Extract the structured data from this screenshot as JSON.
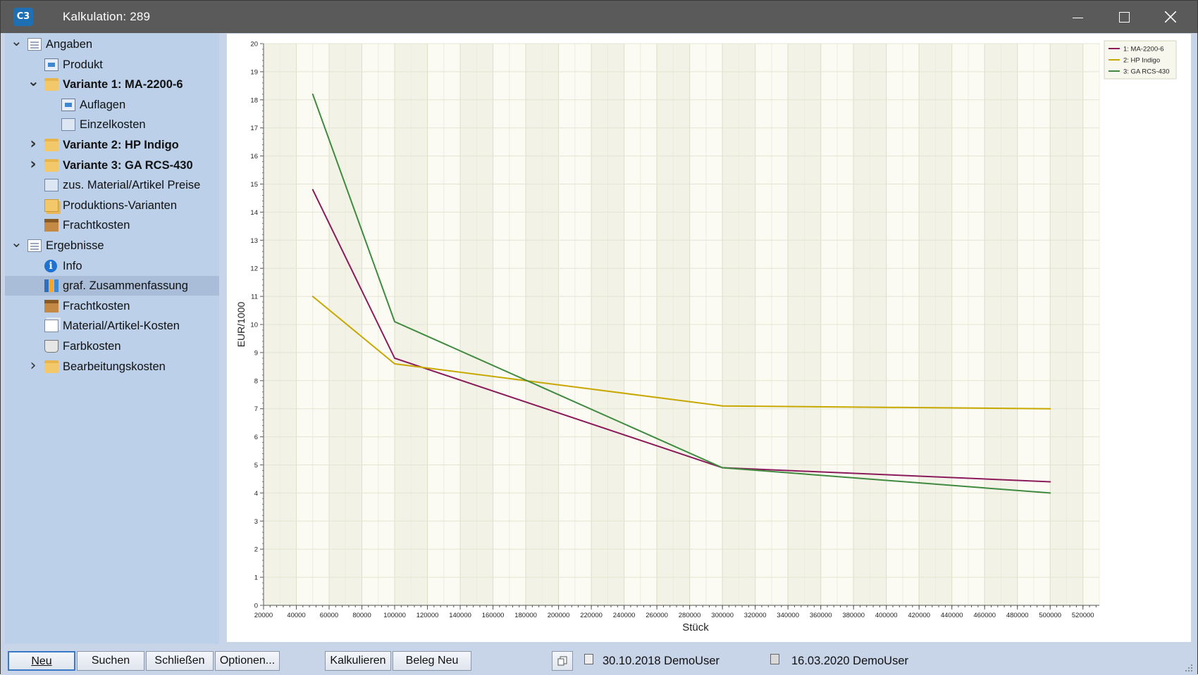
{
  "window": {
    "title": "Kalkulation: 289",
    "app_icon_text": "C3"
  },
  "tree": [
    {
      "label": "Angaben",
      "level": 0,
      "chevron": "expanded",
      "icon": "doc-icon",
      "bold": false
    },
    {
      "label": "Produkt",
      "level": 1,
      "chevron": "none",
      "icon": "monitor-icon",
      "bold": false
    },
    {
      "label": "Variante 1: MA-2200-6",
      "level": 1,
      "chevron": "expanded",
      "icon": "folder-icon",
      "bold": true
    },
    {
      "label": "Auflagen",
      "level": 2,
      "chevron": "none",
      "icon": "monitor-icon",
      "bold": false
    },
    {
      "label": "Einzelkosten",
      "level": 2,
      "chevron": "none",
      "icon": "calc-icon",
      "bold": false
    },
    {
      "label": "Variante 2: HP Indigo",
      "level": 1,
      "chevron": "collapsed",
      "icon": "folder-icon",
      "bold": true
    },
    {
      "label": "Variante 3: GA RCS-430",
      "level": 1,
      "chevron": "collapsed",
      "icon": "folder-icon",
      "bold": true
    },
    {
      "label": "zus. Material/Artikel Preise",
      "level": 1,
      "chevron": "none",
      "icon": "calc-icon",
      "bold": false
    },
    {
      "label": "Produktions-Varianten",
      "level": 1,
      "chevron": "none",
      "icon": "stack-icon",
      "bold": false
    },
    {
      "label": "Frachtkosten",
      "level": 1,
      "chevron": "none",
      "icon": "box-icon",
      "bold": false
    },
    {
      "label": "Ergebnisse",
      "level": 0,
      "chevron": "expanded",
      "icon": "doc-icon",
      "bold": false
    },
    {
      "label": "Info",
      "level": 1,
      "chevron": "none",
      "icon": "info-icon",
      "bold": false
    },
    {
      "label": "graf. Zusammenfassung",
      "level": 1,
      "chevron": "none",
      "icon": "chart-icon",
      "bold": false,
      "selected": true
    },
    {
      "label": "Frachtkosten",
      "level": 1,
      "chevron": "none",
      "icon": "box-icon",
      "bold": false
    },
    {
      "label": "Material/Artikel-Kosten",
      "level": 1,
      "chevron": "none",
      "icon": "pages-icon",
      "bold": false
    },
    {
      "label": "Farbkosten",
      "level": 1,
      "chevron": "none",
      "icon": "bucket-icon",
      "bold": false
    },
    {
      "label": "Bearbeitungskosten",
      "level": 1,
      "chevron": "collapsed",
      "icon": "folder-icon",
      "bold": false
    }
  ],
  "chart_data": {
    "type": "line",
    "title": "",
    "xlabel": "Stück",
    "ylabel": "EUR/1000",
    "xlim": [
      20000,
      530000
    ],
    "ylim": [
      0,
      20
    ],
    "x_ticks": [
      20000,
      40000,
      60000,
      80000,
      100000,
      120000,
      140000,
      160000,
      180000,
      200000,
      220000,
      240000,
      260000,
      280000,
      300000,
      320000,
      340000,
      360000,
      380000,
      400000,
      420000,
      440000,
      460000,
      480000,
      500000,
      520000
    ],
    "y_ticks": [
      0,
      1,
      2,
      3,
      4,
      5,
      6,
      7,
      8,
      9,
      10,
      11,
      12,
      13,
      14,
      15,
      16,
      17,
      18,
      19,
      20
    ],
    "grid": true,
    "legend_position": "top-right",
    "series": [
      {
        "name": "1: MA-2200-6",
        "color": "#8b1a5a",
        "x": [
          50000,
          100000,
          300000,
          500000
        ],
        "values": [
          14.8,
          8.8,
          4.9,
          4.4
        ]
      },
      {
        "name": "2: HP Indigo",
        "color": "#c8a800",
        "x": [
          50000,
          100000,
          300000,
          500000
        ],
        "values": [
          11.0,
          8.6,
          7.1,
          7.0
        ]
      },
      {
        "name": "3: GA RCS-430",
        "color": "#3f8a3f",
        "x": [
          50000,
          100000,
          300000,
          500000
        ],
        "values": [
          18.2,
          10.1,
          4.9,
          4.0
        ]
      }
    ]
  },
  "buttons": {
    "neu": "Neu",
    "suchen": "Suchen",
    "schliessen": "Schließen",
    "optionen": "Optionen...",
    "kalkulieren": "Kalkulieren",
    "beleg_neu": "Beleg Neu"
  },
  "status": {
    "created": "30.10.2018 DemoUser",
    "saved": "16.03.2020 DemoUser"
  }
}
